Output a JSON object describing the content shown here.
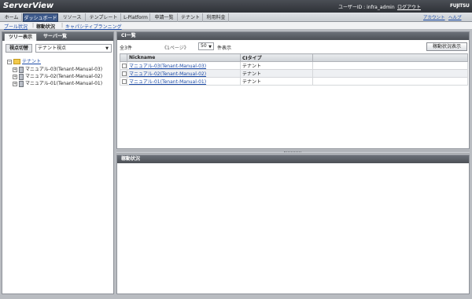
{
  "app": {
    "logo_text": "ServerView",
    "user_info": "ユーザーID : infra_admin",
    "logout_label": "ログアウト",
    "brand_text": "FUJITSU"
  },
  "nav": {
    "tabs": [
      {
        "label": "ホーム",
        "active": false
      },
      {
        "label": "ダッシュボード",
        "active": true
      },
      {
        "label": "リソース",
        "active": false
      },
      {
        "label": "テンプレート",
        "active": false
      },
      {
        "label": "L-Platform",
        "active": false
      },
      {
        "label": "申請一覧",
        "active": false
      },
      {
        "label": "テナント",
        "active": false
      },
      {
        "label": "利用料金",
        "active": false
      }
    ],
    "account_label": "アカウント",
    "help_label": "ヘルプ"
  },
  "subnav": {
    "items": [
      {
        "label": "プール状況",
        "current": false
      },
      {
        "label": "稼動状況",
        "current": true
      },
      {
        "label": "キャパシティプランニング",
        "current": false
      }
    ]
  },
  "left": {
    "tabs": [
      {
        "label": "ツリー表示",
        "active": true
      },
      {
        "label": "サーバ一覧",
        "active": false
      }
    ],
    "viewpoint_label": "視点切替",
    "viewpoint_value": "テナント視点",
    "tree": {
      "root_label": "テナント",
      "children": [
        {
          "label": "マニュアル-03(Tenant-Manual-03)"
        },
        {
          "label": "マニュアル-02(Tenant-Manual-02)"
        },
        {
          "label": "マニュアル-01(Tenant-Manual-01)"
        }
      ]
    }
  },
  "ci_panel": {
    "title": "CI一覧",
    "count_label": "全3件",
    "page_label": "《1ページ》",
    "per_page_value": "50",
    "per_page_suffix": "件表示",
    "status_button_label": "稼動状況表示",
    "columns": [
      "Nickname",
      "CIタイプ"
    ],
    "rows": [
      {
        "nickname": "マニュアル-03(Tenant-Manual-03)",
        "ci_type": "テナント"
      },
      {
        "nickname": "マニュアル-02(Tenant-Manual-02)",
        "ci_type": "テナント"
      },
      {
        "nickname": "マニュアル-01(Tenant-Manual-01)",
        "ci_type": "テナント"
      }
    ]
  },
  "status_panel": {
    "title": "稼動状況"
  },
  "colors": {
    "header_bg": "#3a3d42",
    "active_tab": "#3e5a8a",
    "link": "#1b4aa6",
    "panel_title": "#5a5f66"
  }
}
